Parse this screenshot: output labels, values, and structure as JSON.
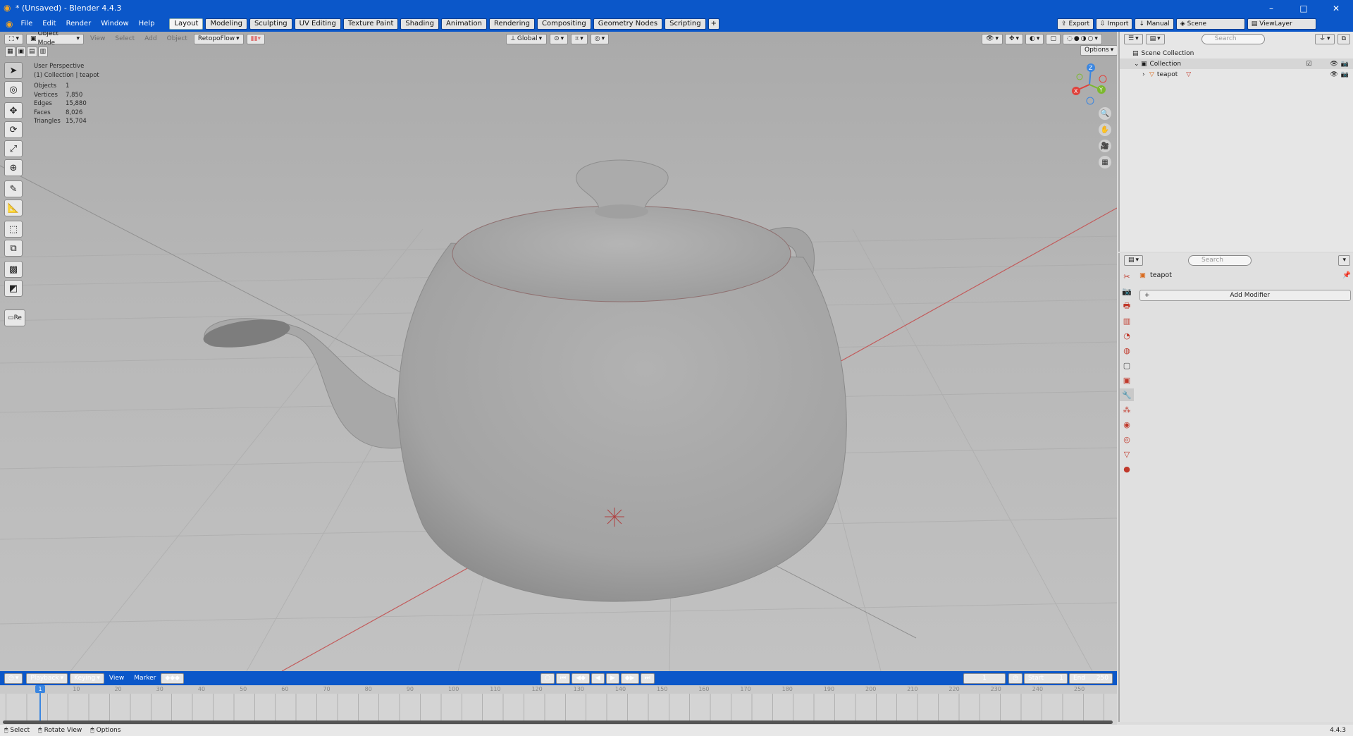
{
  "window": {
    "title": "* (Unsaved) - Blender 4.4.3",
    "minimize": "–",
    "maximize": "□",
    "close": "✕"
  },
  "menus": [
    "File",
    "Edit",
    "Render",
    "Window",
    "Help"
  ],
  "workspaces": [
    "Layout",
    "Modeling",
    "Sculpting",
    "UV Editing",
    "Texture Paint",
    "Shading",
    "Animation",
    "Rendering",
    "Compositing",
    "Geometry Nodes",
    "Scripting"
  ],
  "add_workspace": "+",
  "topright": {
    "export": "Export",
    "import": "Import",
    "manual": "Manual",
    "scene": "Scene",
    "view_layer": "ViewLayer"
  },
  "viewport": {
    "mode": "Object Mode",
    "menus": [
      "View",
      "Select",
      "Add",
      "Object"
    ],
    "addon": "RetopoFlow",
    "orientation": "Global",
    "options": "Options",
    "overlay": {
      "perspective": "User Perspective",
      "collection": "(1) Collection | teapot"
    },
    "stats": [
      {
        "label": "Objects",
        "value": "1"
      },
      {
        "label": "Vertices",
        "value": "7,850"
      },
      {
        "label": "Edges",
        "value": "15,880"
      },
      {
        "label": "Faces",
        "value": "8,026"
      },
      {
        "label": "Triangles",
        "value": "15,704"
      }
    ],
    "gizmo": {
      "x": "X",
      "y": "Y",
      "z": "Z"
    },
    "last_op": "Re"
  },
  "outliner": {
    "search_placeholder": "Search",
    "scene_collection": "Scene Collection",
    "collection": "Collection",
    "object": "teapot"
  },
  "properties": {
    "search_placeholder": "Search",
    "object_name": "teapot",
    "add_modifier": "Add Modifier"
  },
  "timeline": {
    "menus": [
      "Playback",
      "Keying",
      "View",
      "Marker"
    ],
    "current_frame": "1",
    "start_label": "Start",
    "start": "1",
    "end_label": "End",
    "end": "250",
    "ruler": [
      "1",
      "10",
      "20",
      "30",
      "40",
      "50",
      "60",
      "70",
      "80",
      "90",
      "100",
      "110",
      "120",
      "130",
      "140",
      "150",
      "160",
      "170",
      "180",
      "190",
      "200",
      "210",
      "220",
      "230",
      "240",
      "250"
    ]
  },
  "statusbar": {
    "select": "Select",
    "rotate": "Rotate View",
    "options": "Options",
    "version": "4.4.3"
  },
  "colors": {
    "accent": "#0b57c9",
    "viewport_bg": "#b9b9b9",
    "x_axis": "#e0423c",
    "y_axis": "#7cb82e",
    "z_axis": "#3b86e0"
  }
}
